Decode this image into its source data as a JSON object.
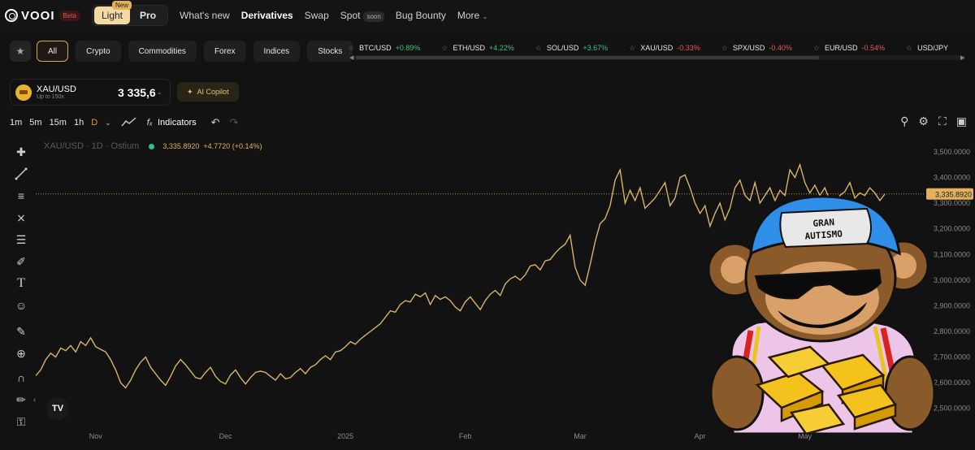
{
  "brand": {
    "name": "VOOI",
    "beta": "Beta"
  },
  "mode": {
    "light": "Light",
    "pro": "Pro",
    "new_badge": "New"
  },
  "nav": {
    "whats_new": "What's new",
    "derivatives": "Derivatives",
    "swap": "Swap",
    "spot": "Spot",
    "soon": "soon",
    "bug_bounty": "Bug Bounty",
    "more": "More"
  },
  "filters": [
    "All",
    "Crypto",
    "Commodities",
    "Forex",
    "Indices",
    "Stocks"
  ],
  "tickers": [
    {
      "sym": "BTC/USD",
      "chg": "+0.89%",
      "dir": "pos"
    },
    {
      "sym": "ETH/USD",
      "chg": "+4.22%",
      "dir": "pos"
    },
    {
      "sym": "SOL/USD",
      "chg": "+3.67%",
      "dir": "pos"
    },
    {
      "sym": "XAU/USD",
      "chg": "-0.33%",
      "dir": "neg"
    },
    {
      "sym": "SPX/USD",
      "chg": "-0.40%",
      "dir": "neg"
    },
    {
      "sym": "EUR/USD",
      "chg": "-0.54%",
      "dir": "neg"
    },
    {
      "sym": "USD/JPY",
      "chg": "",
      "dir": "pos"
    }
  ],
  "asset": {
    "name": "XAU/USD",
    "leverage": "Up to 150x",
    "price": "3 335,6"
  },
  "copilot": "AI Copilot",
  "timeframes": [
    "1m",
    "5m",
    "15m",
    "1h",
    "D"
  ],
  "indicators_label": "Indicators",
  "legend": {
    "symbol": "XAU/USD · 1D · Ostium",
    "value": "3,335.8920",
    "change": "+4.7720 (+0.14%)"
  },
  "colors": {
    "accent": "#e1b15d",
    "line": "#d8b46a",
    "positive": "#3ec07b",
    "negative": "#e05a5a"
  },
  "chart_data": {
    "type": "line",
    "series": [
      {
        "values": [
          2627,
          2650,
          2690,
          2715,
          2700,
          2735,
          2725,
          2745,
          2720,
          2760,
          2745,
          2775,
          2740,
          2730,
          2720,
          2690,
          2650,
          2600,
          2580,
          2610,
          2650,
          2680,
          2700,
          2660,
          2635,
          2610,
          2590,
          2625,
          2665,
          2690,
          2670,
          2645,
          2620,
          2615,
          2640,
          2660,
          2625,
          2605,
          2595,
          2630,
          2650,
          2620,
          2595,
          2620,
          2640,
          2645,
          2640,
          2625,
          2610,
          2635,
          2615,
          2620,
          2640,
          2655,
          2635,
          2660,
          2670,
          2690,
          2705,
          2690,
          2720,
          2725,
          2740,
          2760,
          2750,
          2770,
          2785,
          2800,
          2815,
          2830,
          2855,
          2880,
          2875,
          2905,
          2920,
          2915,
          2945,
          2935,
          2950,
          2905,
          2940,
          2925,
          2935,
          2920,
          2895,
          2880,
          2915,
          2935,
          2910,
          2885,
          2920,
          2945,
          2960,
          2940,
          2985,
          3005,
          3015,
          3000,
          3020,
          3055,
          3060,
          3040,
          3075,
          3080,
          3105,
          3125,
          3140,
          3175,
          3050,
          3000,
          2980,
          3060,
          3150,
          3220,
          3240,
          3290,
          3390,
          3430,
          3300,
          3350,
          3310,
          3360,
          3280,
          3300,
          3320,
          3350,
          3380,
          3290,
          3320,
          3400,
          3410,
          3360,
          3300,
          3260,
          3290,
          3210,
          3260,
          3300,
          3235,
          3280,
          3360,
          3390,
          3330,
          3310,
          3380,
          3300,
          3330,
          3360,
          3310,
          3350,
          3330,
          3430,
          3400,
          3450,
          3380,
          3340,
          3370,
          3330,
          3360,
          3310,
          3280,
          3330,
          3345,
          3380,
          3320,
          3340,
          3330,
          3360,
          3340,
          3310,
          3335.89
        ]
      }
    ],
    "last_value": "3,335.8920",
    "ylim": [
      2420,
      3560
    ],
    "y_ticks": [
      "3,500.0000",
      "3,400.0000",
      "3,300.0000",
      "3,200.0000",
      "3,100.0000",
      "3,000.0000",
      "2,900.0000",
      "2,800.0000",
      "2,700.0000",
      "2,600.0000",
      "2,500.0000"
    ],
    "y_tick_values": [
      3500,
      3400,
      3300,
      3200,
      3100,
      3000,
      2900,
      2800,
      2700,
      2600,
      2500
    ],
    "x_ticks": [
      "Nov",
      "Dec",
      "2025",
      "Feb",
      "Mar",
      "Apr",
      "May"
    ],
    "x_tick_indices": [
      12,
      38,
      62,
      86,
      109,
      133,
      154
    ],
    "grid": false
  },
  "mascot": {
    "cap_text": "GRAN AUTISMO"
  }
}
